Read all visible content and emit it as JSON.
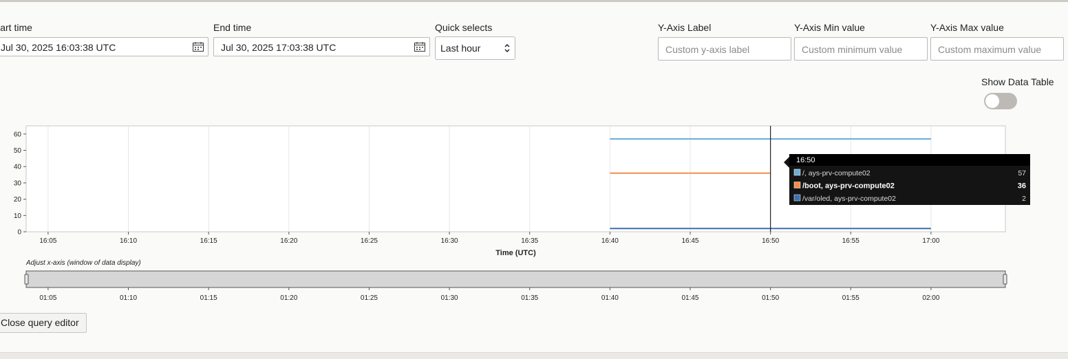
{
  "controls": {
    "start_time_label": "Start time",
    "start_time_value": "Jul 30, 2025 16:03:38 UTC",
    "end_time_label": "End time",
    "end_time_value": "Jul 30, 2025 17:03:38 UTC",
    "quick_selects_label": "Quick selects",
    "quick_selects_value": "Last hour",
    "y_label_label": "Y-Axis Label",
    "y_label_placeholder": "Custom y-axis label",
    "y_min_label": "Y-Axis Min value",
    "y_min_placeholder": "Custom minimum value",
    "y_max_label": "Y-Axis Max value",
    "y_max_placeholder": "Custom maximum value",
    "show_data_table_label": "Show Data Table",
    "show_data_table_on": false,
    "close_button": "Close query editor"
  },
  "chart_data": {
    "type": "line",
    "xlabel": "Time (UTC)",
    "ylabel": "",
    "ylim": [
      0,
      65
    ],
    "y_ticks": [
      "0",
      "10",
      "20",
      "30",
      "40",
      "50",
      "60"
    ],
    "x_ticks": [
      "16:05",
      "16:10",
      "16:15",
      "16:20",
      "16:25",
      "16:30",
      "16:35",
      "16:40",
      "16:45",
      "16:50",
      "16:55",
      "17:00"
    ],
    "x_range": [
      "16:03",
      "17:04"
    ],
    "grid": "vertical",
    "series": [
      {
        "name": "/, ays-prv-compute02",
        "color": "#6baed6",
        "x": [
          "16:40",
          "17:00"
        ],
        "values": [
          57,
          57
        ]
      },
      {
        "name": "/boot, ays-prv-compute02",
        "color": "#f28e4c",
        "x": [
          "16:40",
          "16:50"
        ],
        "values": [
          36,
          36
        ]
      },
      {
        "name": "/var/oled, ays-prv-compute02",
        "color": "#3f6fae",
        "x": [
          "16:40",
          "17:00"
        ],
        "values": [
          2,
          2
        ]
      }
    ],
    "tooltip": {
      "time": "16:50",
      "rows": [
        {
          "name": "/, ays-prv-compute02",
          "value": "57",
          "color": "#6baed6",
          "bold": false
        },
        {
          "name": "/boot, ays-prv-compute02",
          "value": "36",
          "color": "#f28e4c",
          "bold": true
        },
        {
          "name": "/var/oled, ays-prv-compute02",
          "value": "2",
          "color": "#3f6fae",
          "bold": false
        }
      ]
    },
    "brush": {
      "caption": "Adjust x-axis (window of data display)",
      "ticks": [
        "01:05",
        "01:10",
        "01:15",
        "01:20",
        "01:25",
        "01:30",
        "01:35",
        "01:40",
        "01:45",
        "01:50",
        "01:55",
        "02:00"
      ]
    }
  }
}
